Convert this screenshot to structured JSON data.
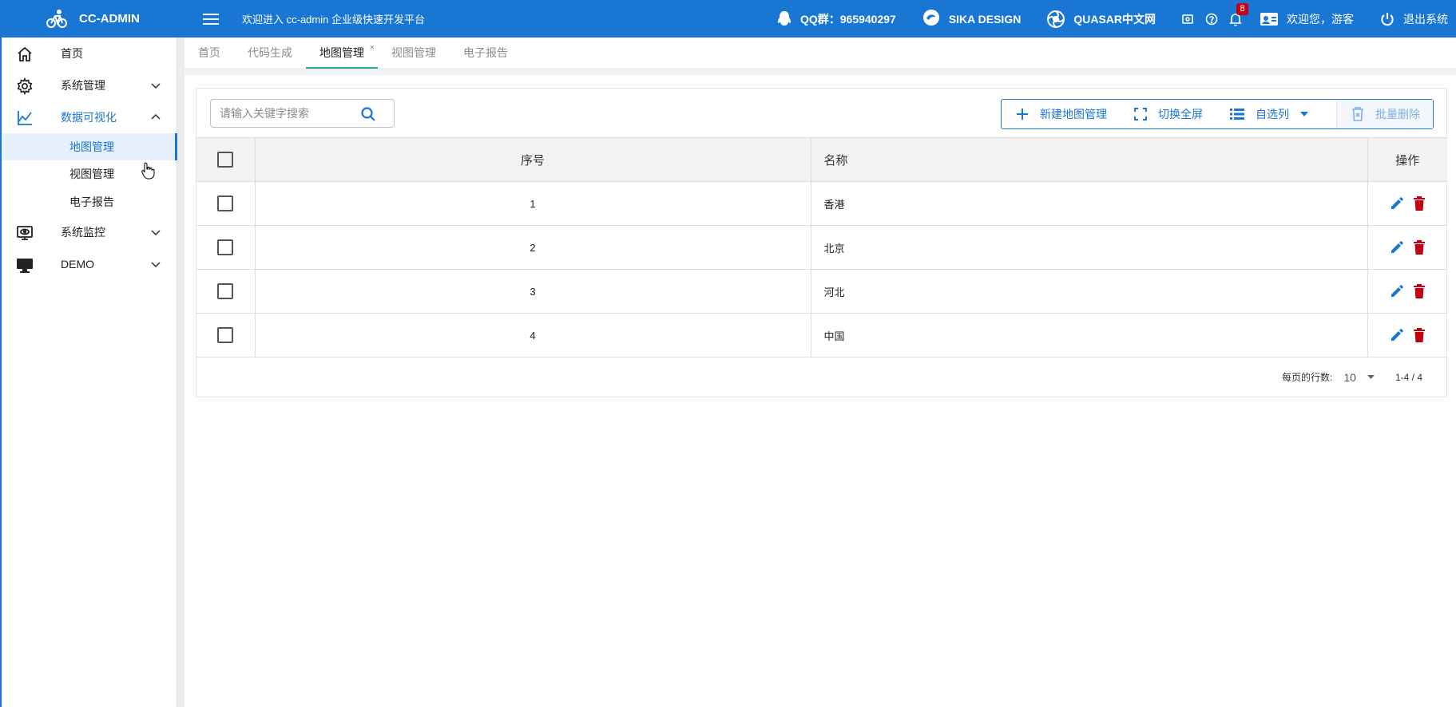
{
  "header": {
    "app_name": "CC-ADMIN",
    "welcome": "欢迎进入 cc-admin 企业级快速开发平台",
    "qq_group": "QQ群：965940297",
    "sika": "SIKA DESIGN",
    "quasar": "QUASAR中文网",
    "notification_count": "8",
    "user_greeting": "欢迎您，游客",
    "logout": "退出系统",
    "brand_color": "#1976d2"
  },
  "sidebar": {
    "items": [
      {
        "label": "首页",
        "icon": "home-icon"
      },
      {
        "label": "系统管理",
        "icon": "gear-icon"
      },
      {
        "label": "数据可视化",
        "icon": "chart-icon"
      },
      {
        "label": "系统监控",
        "icon": "monitor-eye-icon"
      },
      {
        "label": "DEMO",
        "icon": "desktop-icon"
      }
    ],
    "subitems": [
      {
        "label": "地图管理"
      },
      {
        "label": "视图管理"
      },
      {
        "label": "电子报告"
      }
    ]
  },
  "tabs": [
    {
      "label": "首页"
    },
    {
      "label": "代码生成"
    },
    {
      "label": "地图管理",
      "close": "×"
    },
    {
      "label": "视图管理"
    },
    {
      "label": "电子报告"
    }
  ],
  "toolbar": {
    "search_placeholder": "请输入关键字搜索",
    "new_label": "新建地图管理",
    "fullscreen_label": "切换全屏",
    "columns_label": "自选列",
    "batch_delete_label": "批量删除"
  },
  "table": {
    "headers": {
      "index": "序号",
      "name": "名称",
      "ops": "操作"
    },
    "rows": [
      {
        "index": "1",
        "name": "香港"
      },
      {
        "index": "2",
        "name": "北京"
      },
      {
        "index": "3",
        "name": "河北"
      },
      {
        "index": "4",
        "name": "中国"
      }
    ]
  },
  "pager": {
    "rows_label": "每页的行数:",
    "rows_per_page": "10",
    "range": "1-4 / 4"
  },
  "colors": {
    "primary": "#1976d2",
    "danger": "#c10015",
    "tab_indicator": "#26a69a"
  }
}
